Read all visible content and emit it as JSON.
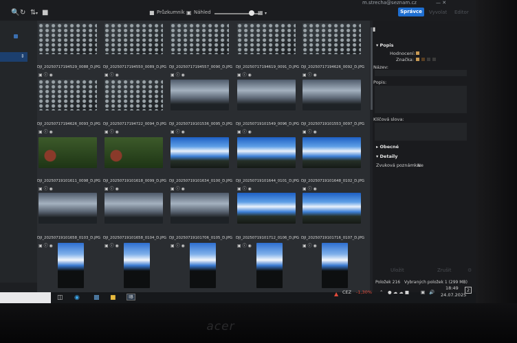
{
  "toolbar": {
    "explorer_label": "Průzkumník",
    "preview_label": "Náhled",
    "user_label": "m.strecha@seznam.cz",
    "manager_label": "Správce",
    "export_label": "Vyvolat",
    "edit_label": "Editor"
  },
  "colors": {
    "accent": "#1f6fd1",
    "gallery_bg": "#2a2d31",
    "panel_bg": "#1a1b1e",
    "stock_down": "#e04a3a"
  },
  "gallery": {
    "rows": [
      {
        "captions": [
          "",
          "",
          "",
          "",
          ""
        ],
        "kinds": [
          "aerial",
          "aerial",
          "aerial",
          "aerial",
          "aerial"
        ]
      },
      {
        "captions": [
          "DJI_20250717194529_0088_D.JPG",
          "DJI_20250717194550_0089_D.JPG",
          "DJI_20250717194557_0090_D.JPG",
          "DJI_20250717194619_0091_D.JPG",
          "DJI_20250717194626_0092_D.JPG"
        ],
        "kinds": [
          "aerial",
          "aerial",
          "cloud",
          "cloud",
          "cloud"
        ]
      },
      {
        "captions": [
          "DJI_20250717194626_0093_D.JPG",
          "DJI_20250717194722_0094_D.JPG",
          "DJI_20250719101536_0095_D.JPG",
          "DJI_20250719101549_0096_D.JPG",
          "DJI_20250719101553_0097_D.JPG"
        ],
        "kinds": [
          "forest",
          "forest",
          "sky",
          "sky",
          "sky"
        ]
      },
      {
        "captions": [
          "DJI_20250719101611_0098_D.JPG",
          "DJI_20250719101618_0099_D.JPG",
          "DJI_20250719101634_0100_D.JPG",
          "DJI_20250719101644_0101_D.JPG",
          "DJI_20250719101648_0102_D.JPG"
        ],
        "kinds": [
          "cloud",
          "cloud",
          "cloud",
          "sky",
          "sky"
        ]
      },
      {
        "captions": [
          "DJI_20250719101658_0103_D.JPG",
          "DJI_20250719101658_0104_D.JPG",
          "DJI_20250719101706_0105_D.JPG",
          "DJI_20250719101712_0106_D.JPG",
          "DJI_20250719101716_0107_D.JPG"
        ],
        "kinds": [
          "portrait",
          "portrait",
          "portrait",
          "portrait",
          "portrait"
        ]
      }
    ]
  },
  "panel": {
    "section_title": "Popis",
    "rating_label": "Hodnocení:",
    "tag_label": "Značka:",
    "name_label": "Název:",
    "desc_label": "Popis:",
    "keywords_label": "Klíčová slova:",
    "general_label": "Obecné",
    "details_label": "Detaily",
    "voice_label": "Zvuková poznámka:",
    "voice_value": "Ne",
    "save_label": "Uložit",
    "cancel_label": "Zrušit"
  },
  "status": {
    "items_label": "Položek 216",
    "selected_label": "Vybraných položek 1 (299 MB)"
  },
  "taskbar": {
    "stock_name": "CEZ",
    "stock_change": "-1,30%",
    "time": "18:49",
    "date": "24.07.2025",
    "notification_count": "2",
    "app_label": "IB"
  },
  "device": {
    "brand": "acer"
  }
}
